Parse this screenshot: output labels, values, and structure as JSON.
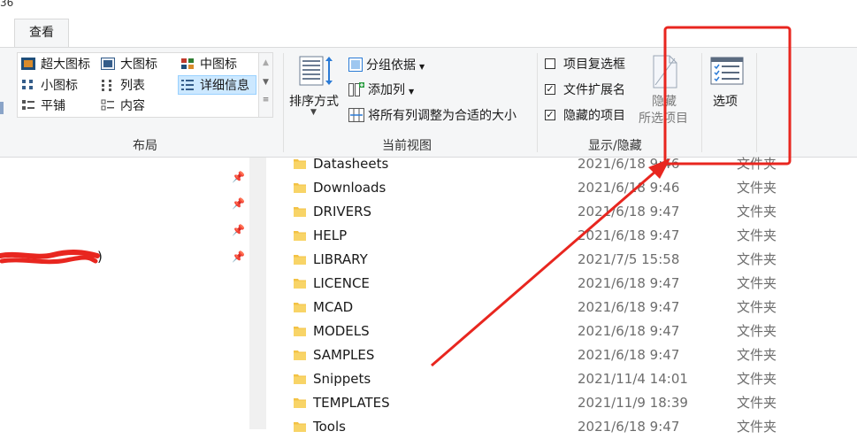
{
  "top_fragment": "36",
  "tabs": [
    {
      "label": "查看"
    }
  ],
  "ribbon": {
    "layout": {
      "group_label": "布局",
      "items": [
        {
          "label": "超大图标",
          "icon": "extra-large-icons-icon"
        },
        {
          "label": "大图标",
          "icon": "large-icons-icon"
        },
        {
          "label": "中图标",
          "icon": "medium-icons-icon"
        },
        {
          "label": "小图标",
          "icon": "small-icons-icon"
        },
        {
          "label": "列表",
          "icon": "list-icon"
        },
        {
          "label": "详细信息",
          "icon": "details-icon",
          "selected": true
        },
        {
          "label": "平铺",
          "icon": "tiles-icon"
        },
        {
          "label": "内容",
          "icon": "content-icon"
        }
      ]
    },
    "current_view": {
      "group_label": "当前视图",
      "sort_label": "排序方式",
      "group_by_label": "分组依据",
      "add_column_label": "添加列",
      "fit_columns_label": "将所有列调整为合适的大小"
    },
    "show_hide": {
      "group_label": "显示/隐藏",
      "item_checkboxes": {
        "label": "项目复选框",
        "checked": false
      },
      "file_extensions": {
        "label": "文件扩展名",
        "checked": true
      },
      "hidden_items": {
        "label": "隐藏的项目",
        "checked": true
      },
      "hide_selected_line1": "隐藏",
      "hide_selected_line2": "所选项目"
    },
    "options": {
      "label": "选项"
    }
  },
  "files": [
    {
      "name": "Datasheets",
      "date": "2021/6/18 9:46",
      "type": "文件夹"
    },
    {
      "name": "Downloads",
      "date": "2021/6/18 9:46",
      "type": "文件夹"
    },
    {
      "name": "DRIVERS",
      "date": "2021/6/18 9:47",
      "type": "文件夹"
    },
    {
      "name": "HELP",
      "date": "2021/6/18 9:47",
      "type": "文件夹"
    },
    {
      "name": "LIBRARY",
      "date": "2021/7/5 15:58",
      "type": "文件夹"
    },
    {
      "name": "LICENCE",
      "date": "2021/6/18 9:47",
      "type": "文件夹"
    },
    {
      "name": "MCAD",
      "date": "2021/6/18 9:47",
      "type": "文件夹"
    },
    {
      "name": "MODELS",
      "date": "2021/6/18 9:47",
      "type": "文件夹"
    },
    {
      "name": "SAMPLES",
      "date": "2021/6/18 9:47",
      "type": "文件夹"
    },
    {
      "name": "Snippets",
      "date": "2021/11/4 14:01",
      "type": "文件夹"
    },
    {
      "name": "TEMPLATES",
      "date": "2021/11/9 18:39",
      "type": "文件夹"
    },
    {
      "name": "Tools",
      "date": "2021/6/18 9:47",
      "type": "文件夹"
    }
  ],
  "left_pane": {
    "fragment": ")"
  },
  "colors": {
    "annotation_red": "#e8261f",
    "selection_blue": "#cce8ff",
    "folder_yellow": "#f3c244"
  }
}
